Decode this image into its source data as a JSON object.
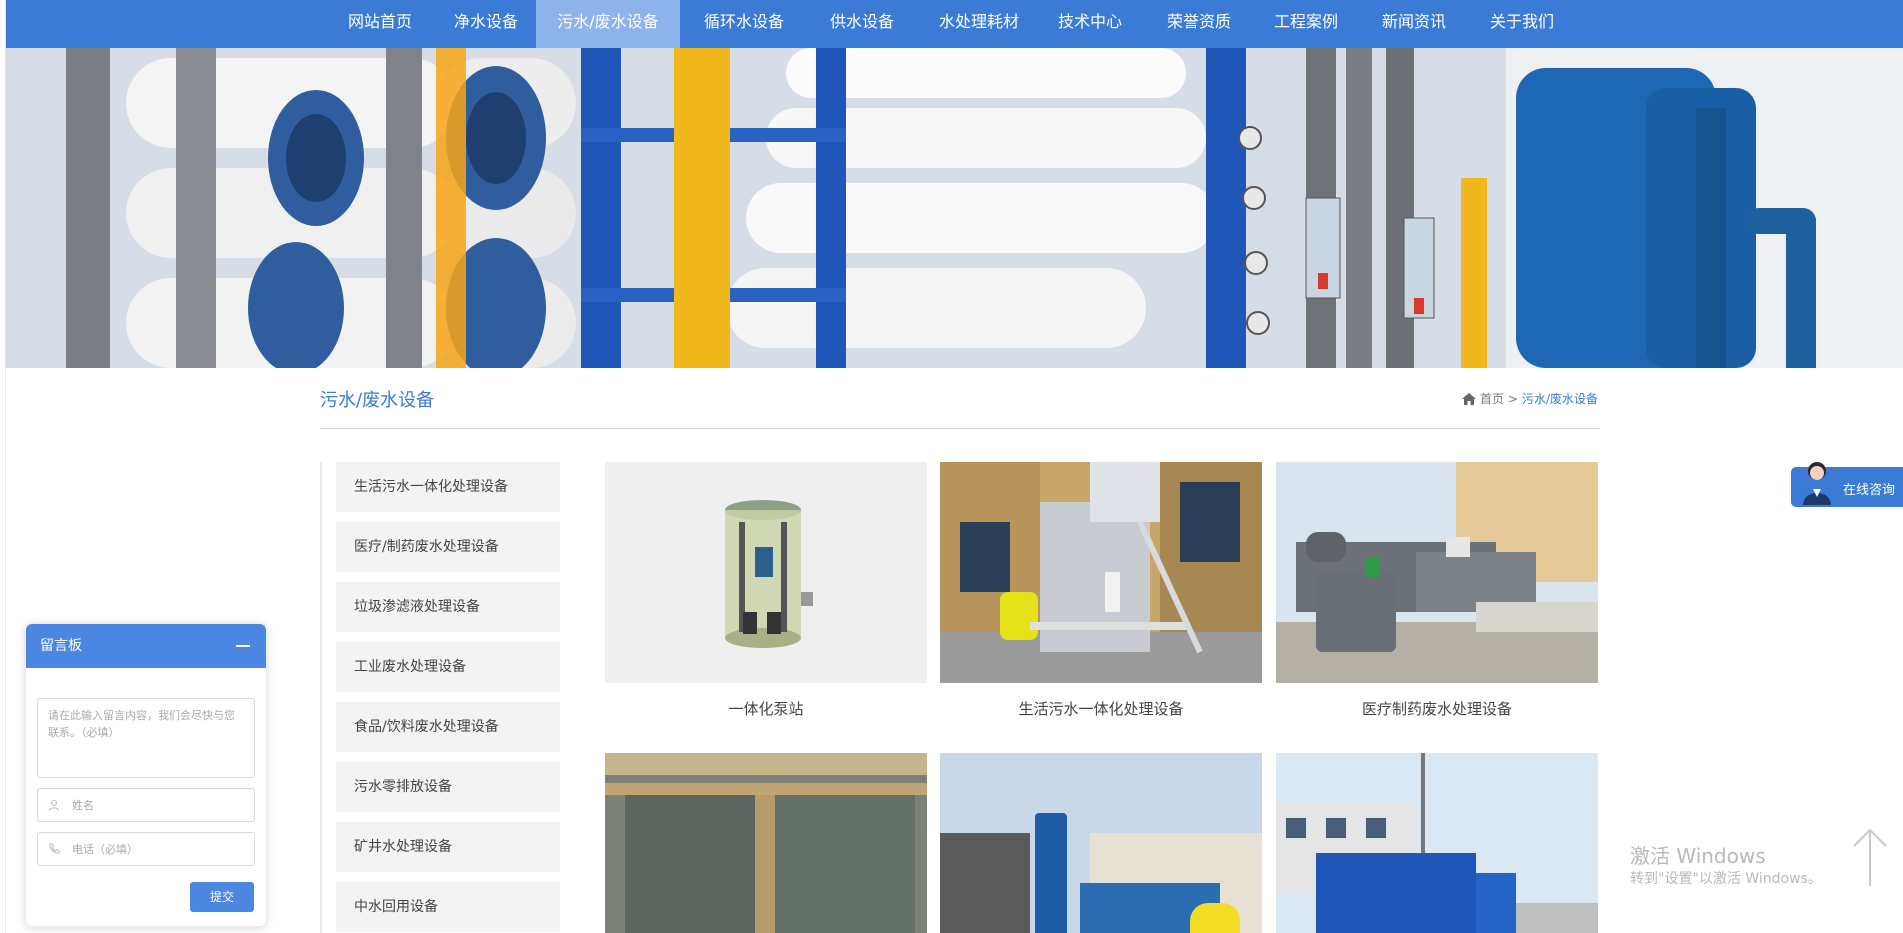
{
  "nav": {
    "items": [
      {
        "label": "网站首页",
        "active": false
      },
      {
        "label": "净水设备",
        "active": false
      },
      {
        "label": "污水/废水设备",
        "active": true
      },
      {
        "label": "循环水设备",
        "active": false
      },
      {
        "label": "供水设备",
        "active": false
      },
      {
        "label": "水处理耗材",
        "active": false
      },
      {
        "label": "技术中心",
        "active": false
      },
      {
        "label": "荣誉资质",
        "active": false
      },
      {
        "label": "工程案例",
        "active": false
      },
      {
        "label": "新闻资讯",
        "active": false
      },
      {
        "label": "关于我们",
        "active": false
      }
    ]
  },
  "section": {
    "title": "污水/废水设备",
    "breadcrumb": {
      "home": "首页",
      "separator": ">",
      "current": "污水/废水设备"
    }
  },
  "sidebar": {
    "items": [
      {
        "label": "生活污水一体化处理设备"
      },
      {
        "label": "医疗/制药废水处理设备"
      },
      {
        "label": "垃圾渗滤液处理设备"
      },
      {
        "label": "工业废水处理设备"
      },
      {
        "label": "食品/饮料废水处理设备"
      },
      {
        "label": "污水零排放设备"
      },
      {
        "label": "矿井水处理设备"
      },
      {
        "label": "中水回用设备"
      }
    ]
  },
  "products": {
    "items": [
      {
        "caption": "一体化泵站",
        "icon": "pump-station-image"
      },
      {
        "caption": "生活污水一体化处理设备",
        "icon": "sewage-equipment-image"
      },
      {
        "caption": "医疗制药废水处理设备",
        "icon": "medical-wastewater-image"
      },
      {
        "caption": "",
        "icon": "sedimentation-tank-image"
      },
      {
        "caption": "",
        "icon": "blue-tank-site-image"
      },
      {
        "caption": "",
        "icon": "blue-container-image"
      }
    ]
  },
  "message_board": {
    "title": "留言板",
    "content_placeholder": "请在此输入留言内容，我们会尽快与您联系。（必填）",
    "name_placeholder": "姓名",
    "phone_placeholder": "电话（必填）",
    "submit_label": "提交"
  },
  "consult": {
    "label": "在线咨询"
  },
  "watermark": {
    "title": "激活 Windows",
    "subtitle": "转到\"设置\"以激活 Windows。"
  },
  "colors": {
    "primary": "#3b7bd6",
    "nav_active": "#8db3ea",
    "panel": "#4b87e0"
  }
}
